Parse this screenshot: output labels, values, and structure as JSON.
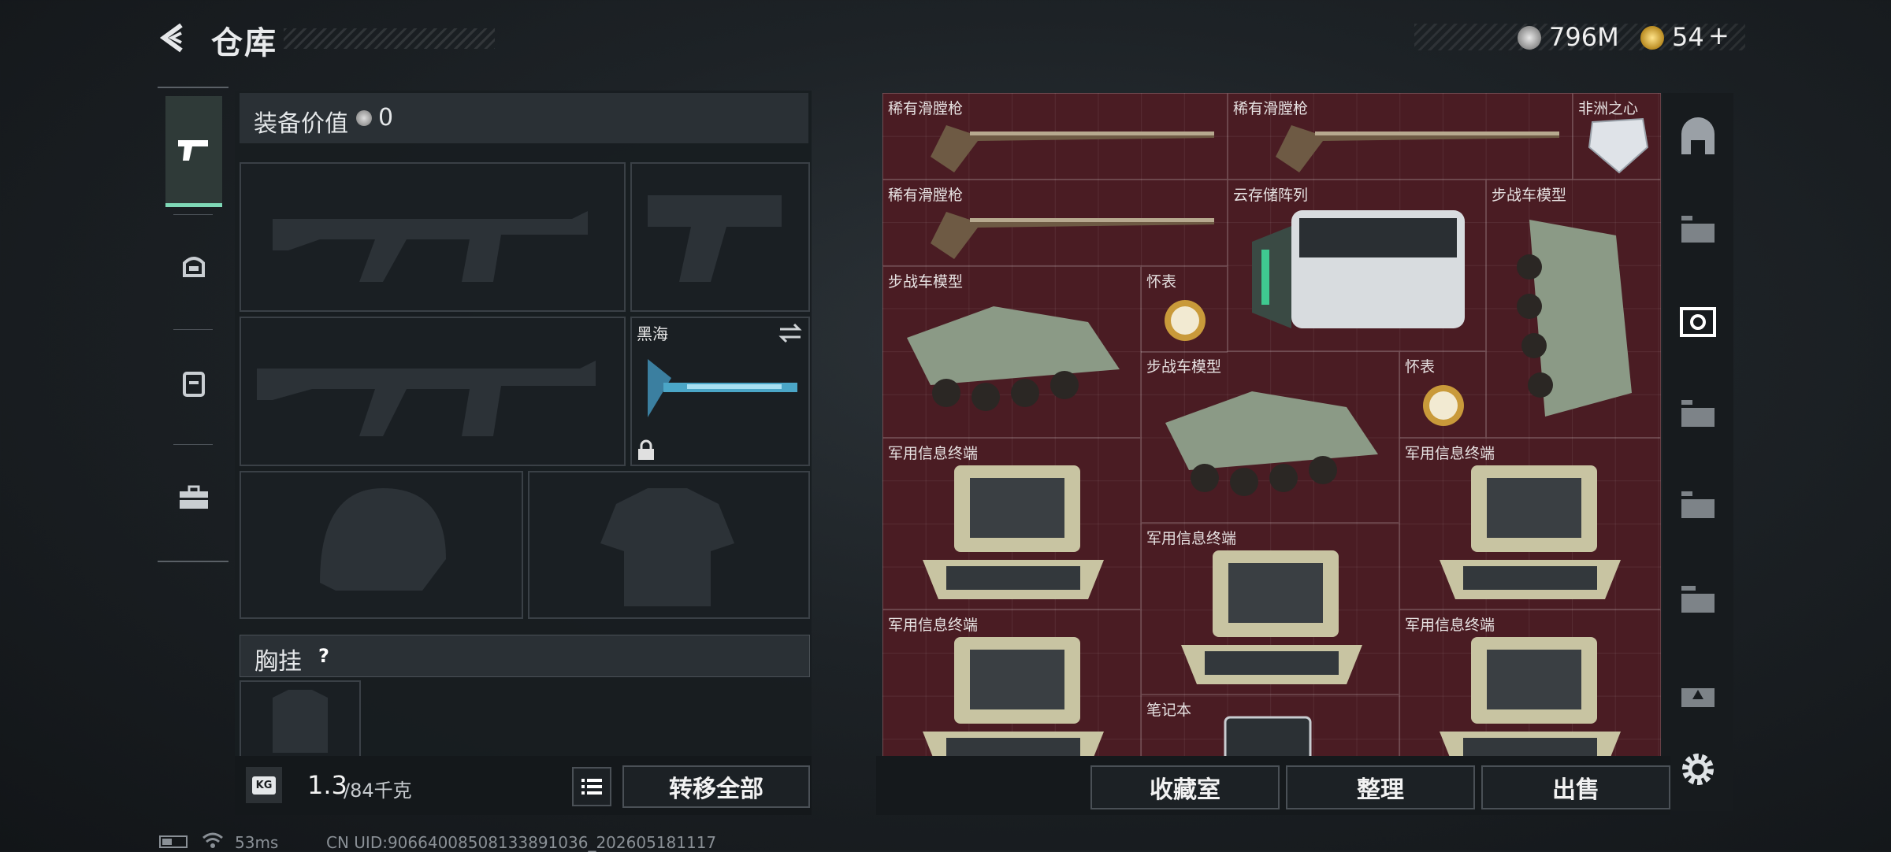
{
  "header": {
    "title": "仓库",
    "currency_silver": "796M",
    "currency_gold": "54",
    "plus": "+"
  },
  "left": {
    "value_label": "装备价值",
    "value": "0",
    "melee_name": "黑海",
    "chest_label": "胸挂",
    "chest_help": "?",
    "weight_value": "1.3",
    "weight_max": "/84千克",
    "transfer_all": "转移全部",
    "weight_icon_text": "KG"
  },
  "stash_items": [
    {
      "label": "稀有滑膛枪"
    },
    {
      "label": "稀有滑膛枪"
    },
    {
      "label": "非洲之心"
    },
    {
      "label": "稀有滑膛枪"
    },
    {
      "label": "云存储阵列"
    },
    {
      "label": "步战车模型"
    },
    {
      "label": "步战车模型"
    },
    {
      "label": "怀表"
    },
    {
      "label": "步战车模型"
    },
    {
      "label": "怀表"
    },
    {
      "label": "军用信息终端"
    },
    {
      "label": "军用信息终端"
    },
    {
      "label": "军用信息终端"
    },
    {
      "label": "军用信息终端"
    },
    {
      "label": "军用信息终端"
    },
    {
      "label": "笔记本"
    }
  ],
  "bottom": {
    "collection": "收藏室",
    "organize": "整理",
    "sell": "出售"
  },
  "status": {
    "ping": "53ms",
    "uid": "CN UID:9066400850813389103​6_202605181117"
  },
  "colors": {
    "accent": "#7fd8b6",
    "stash_bg": "#4a1c23"
  }
}
